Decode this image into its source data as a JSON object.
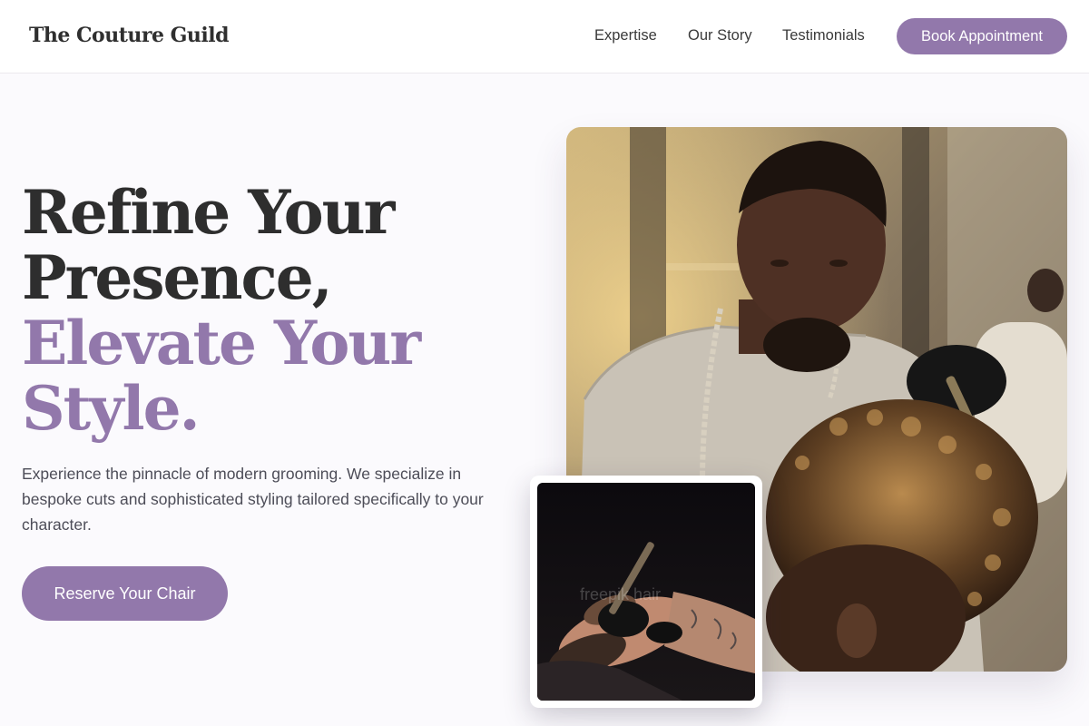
{
  "nav": {
    "brand": "The Couture Guild",
    "links": [
      "Expertise",
      "Our Story",
      "Testimonials"
    ],
    "cta": "Book Appointment"
  },
  "hero": {
    "headline_line1": "Refine Your",
    "headline_line2": "Presence,",
    "headline_accent_line1": "Elevate Your",
    "headline_accent_line2": "Style.",
    "description": "Experience the pinnacle of modern grooming. We specialize in bespoke cuts and sophisticated styling tailored specifically to your character.",
    "cta": "Reserve Your Chair"
  },
  "inset": {
    "watermark": "freepik hair"
  },
  "colors": {
    "accent": "#9278ab",
    "text_dark": "#2e2e2e",
    "background": "#fbfafd"
  }
}
